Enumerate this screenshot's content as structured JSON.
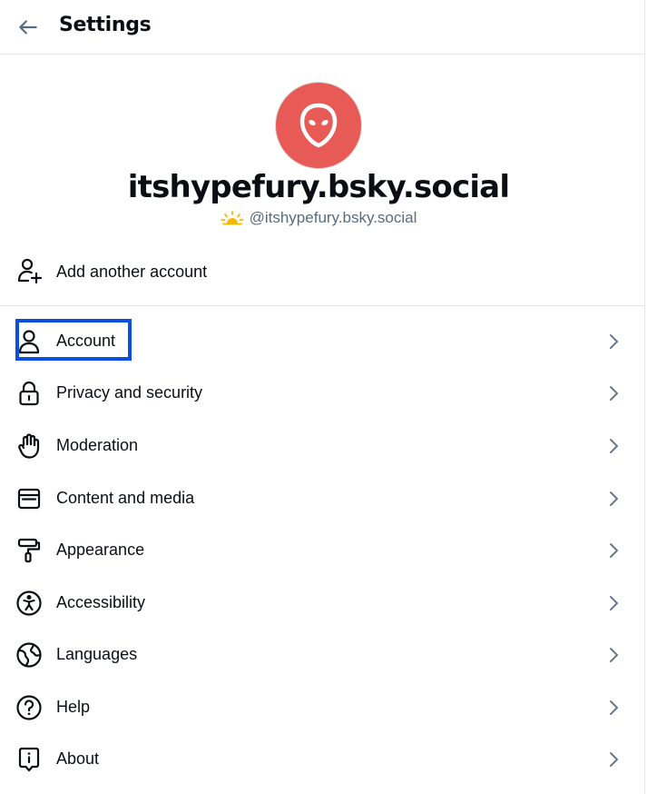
{
  "header": {
    "title": "Settings",
    "back_icon": "arrow-left-icon"
  },
  "profile": {
    "avatar_icon": "alien-avatar-icon",
    "avatar_color": "#e85a56",
    "display_name": "itshypefury.bsky.social",
    "handle": "@itshypefury.bsky.social",
    "handle_badge_icon": "sunrise-icon"
  },
  "add_account": {
    "label": "Add another account",
    "icon": "person-plus-icon"
  },
  "menu": [
    {
      "label": "Account",
      "icon": "person-icon"
    },
    {
      "label": "Privacy and security",
      "icon": "lock-icon"
    },
    {
      "label": "Moderation",
      "icon": "hand-icon"
    },
    {
      "label": "Content and media",
      "icon": "window-icon"
    },
    {
      "label": "Appearance",
      "icon": "paint-roller-icon"
    },
    {
      "label": "Accessibility",
      "icon": "accessibility-icon"
    },
    {
      "label": "Languages",
      "icon": "globe-icon"
    },
    {
      "label": "Help",
      "icon": "question-circle-icon"
    },
    {
      "label": "About",
      "icon": "info-bubble-icon"
    }
  ],
  "highlight_color": "#0a4fe0"
}
